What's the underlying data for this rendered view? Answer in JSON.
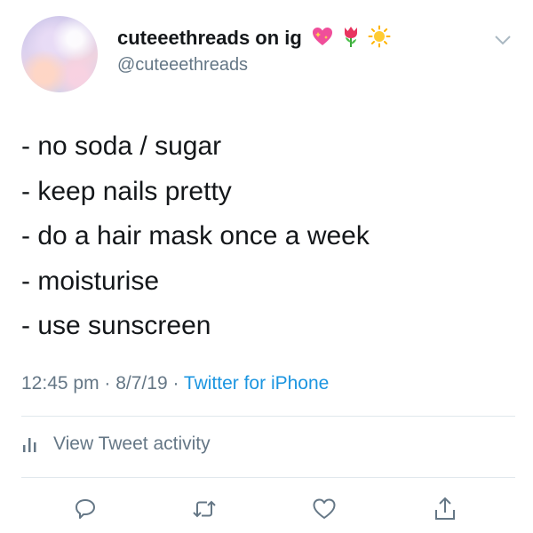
{
  "author": {
    "display_name": "cuteeethreads on ig",
    "handle": "@cuteeethreads",
    "name_emojis": [
      "sparkling-heart",
      "tulip",
      "sun"
    ]
  },
  "tweet": {
    "lines": [
      "- no soda / sugar",
      "- keep nails pretty",
      "- do a hair mask once a week",
      "- moisturise",
      "- use sunscreen"
    ]
  },
  "meta": {
    "time": "12:45 pm",
    "separator": " · ",
    "date": "8/7/19",
    "source": "Twitter for iPhone"
  },
  "activity": {
    "label": "View Tweet activity"
  },
  "actions": [
    "reply-icon",
    "retweet-icon",
    "like-icon",
    "share-icon"
  ],
  "colors": {
    "text": "#14171a",
    "secondary": "#657786",
    "link": "#1b95e0",
    "divider": "#e1e8ed"
  }
}
